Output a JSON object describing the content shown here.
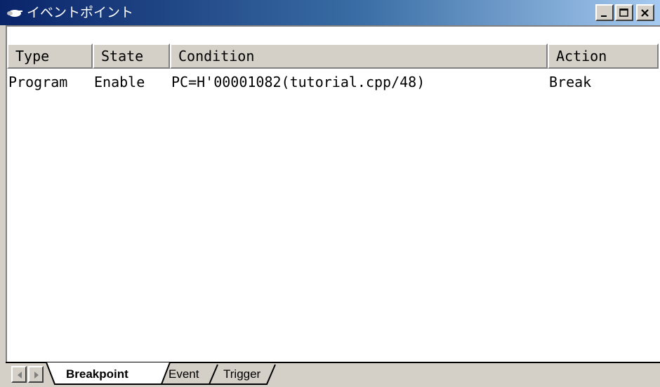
{
  "window": {
    "title": "イベントポイント",
    "icons": {
      "app": "breakpoint-icon",
      "minimize": "minimize-icon",
      "maximize": "maximize-icon",
      "close": "close-icon"
    }
  },
  "table": {
    "columns": [
      "Type",
      "State",
      "Condition",
      "Action"
    ],
    "rows": [
      {
        "type": "Program",
        "state": "Enable",
        "condition": "PC=H'00001082(tutorial.cpp/48)",
        "action": "Break"
      }
    ]
  },
  "tabs": {
    "items": [
      "Breakpoint",
      "Event",
      "Trigger"
    ],
    "active": "Breakpoint"
  },
  "colors": {
    "titlebar_start": "#0a246a",
    "titlebar_end": "#a6caf0",
    "face": "#d4d0c8"
  }
}
